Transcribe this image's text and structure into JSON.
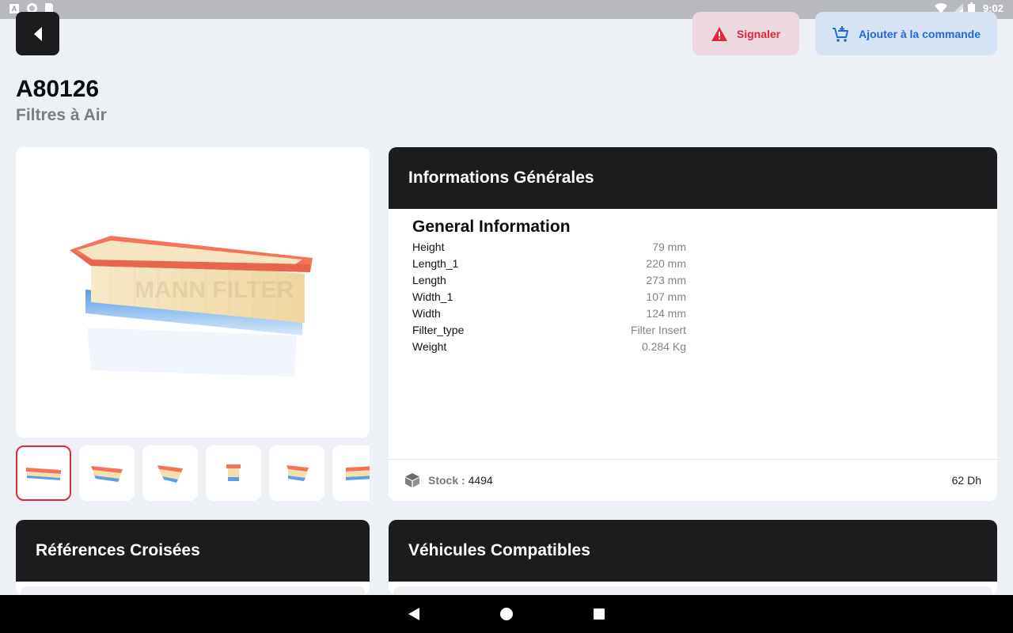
{
  "status_bar": {
    "time": "9:02",
    "left_icon_letter": "A"
  },
  "header": {
    "signal_label": "Signaler",
    "add_to_order_label": "Ajouter à la commande",
    "colors": {
      "signal": "#e3263f",
      "add": "#1f69d6",
      "dark": "#1c1c1e"
    }
  },
  "product": {
    "reference": "A80126",
    "category": "Filtres à Air",
    "image_watermark": "MANN FILTER"
  },
  "info_card": {
    "heading": "Informations Générales",
    "section_title": "General Information",
    "specs": [
      {
        "key": "Height",
        "value": "79 mm"
      },
      {
        "key": "Length_1",
        "value": "220 mm"
      },
      {
        "key": "Length",
        "value": "273 mm"
      },
      {
        "key": "Width_1",
        "value": "107 mm"
      },
      {
        "key": "Width",
        "value": "124 mm"
      },
      {
        "key": "Filter_type",
        "value": "Filter Insert"
      },
      {
        "key": "Weight",
        "value": "0.284 Kg"
      }
    ],
    "stock_label": "Stock : ",
    "stock_value": "4494",
    "price": "62 Dh"
  },
  "cross_references": {
    "heading": "Références Croisées"
  },
  "compatible_vehicles": {
    "heading": "Véhicules Compatibles"
  }
}
